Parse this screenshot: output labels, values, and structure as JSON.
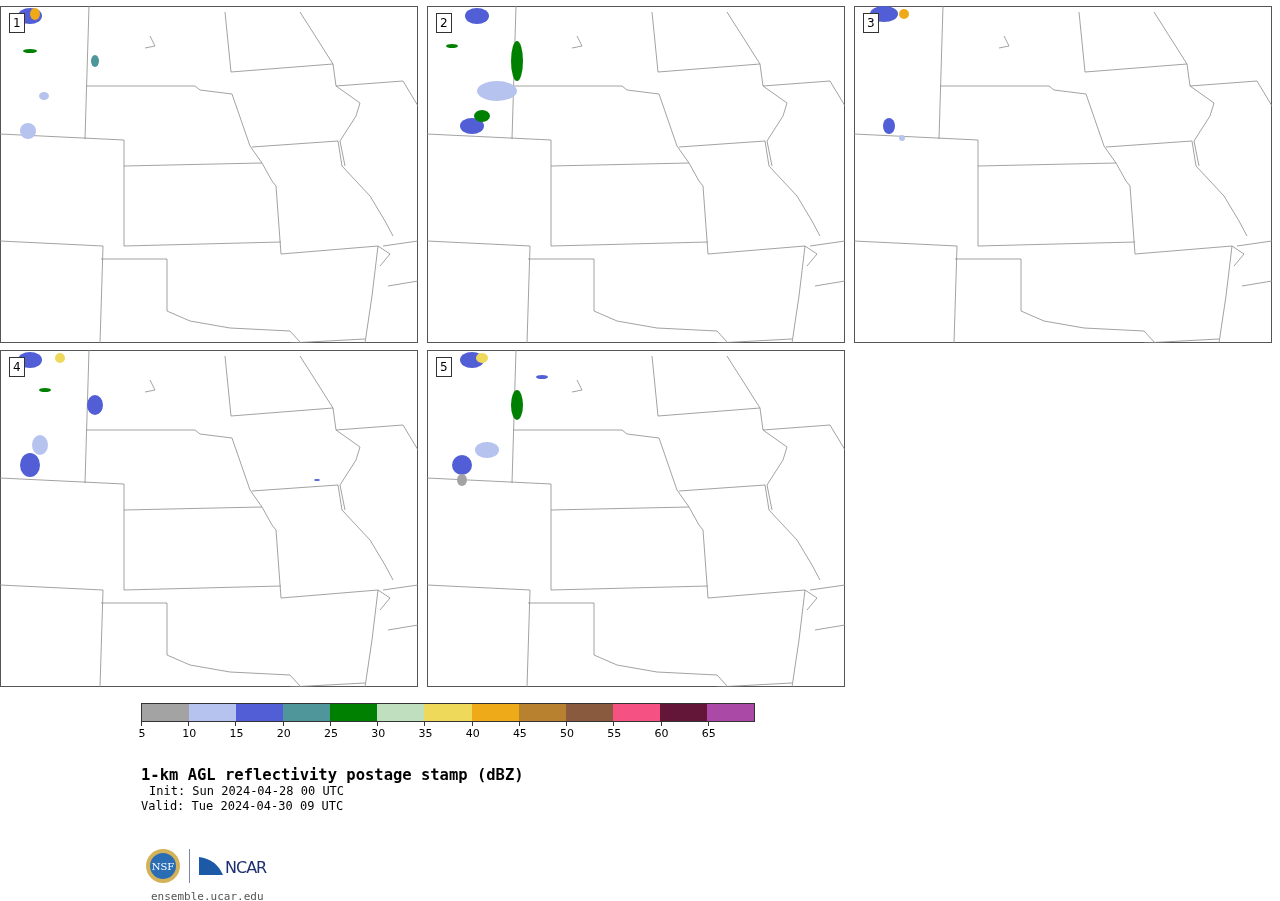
{
  "panels": [
    {
      "label": "1"
    },
    {
      "label": "2"
    },
    {
      "label": "3"
    },
    {
      "label": "4"
    },
    {
      "label": "5"
    }
  ],
  "colorbar": {
    "bins": [
      {
        "color": "#a3a3a3"
      },
      {
        "color": "#b6c3ee"
      },
      {
        "color": "#515ed5"
      },
      {
        "color": "#4f969a"
      },
      {
        "color": "#008000"
      },
      {
        "color": "#bfdfbf"
      },
      {
        "color": "#efd95b"
      },
      {
        "color": "#efaa19"
      },
      {
        "color": "#b8812f"
      },
      {
        "color": "#8a5a3f"
      },
      {
        "color": "#f55183"
      },
      {
        "color": "#631637"
      },
      {
        "color": "#ab4aa6"
      }
    ],
    "ticks": [
      "5",
      "10",
      "15",
      "20",
      "25",
      "30",
      "35",
      "40",
      "45",
      "50",
      "55",
      "60",
      "65"
    ]
  },
  "title": "1-km AGL reflectivity postage stamp (dBZ)",
  "init": "Init: Sun 2024-04-28 00 UTC",
  "valid": "Valid: Tue 2024-04-30 09 UTC",
  "logos": {
    "nsf": "NSF",
    "ncar": "NCAR"
  },
  "site": "ensemble.ucar.edu"
}
